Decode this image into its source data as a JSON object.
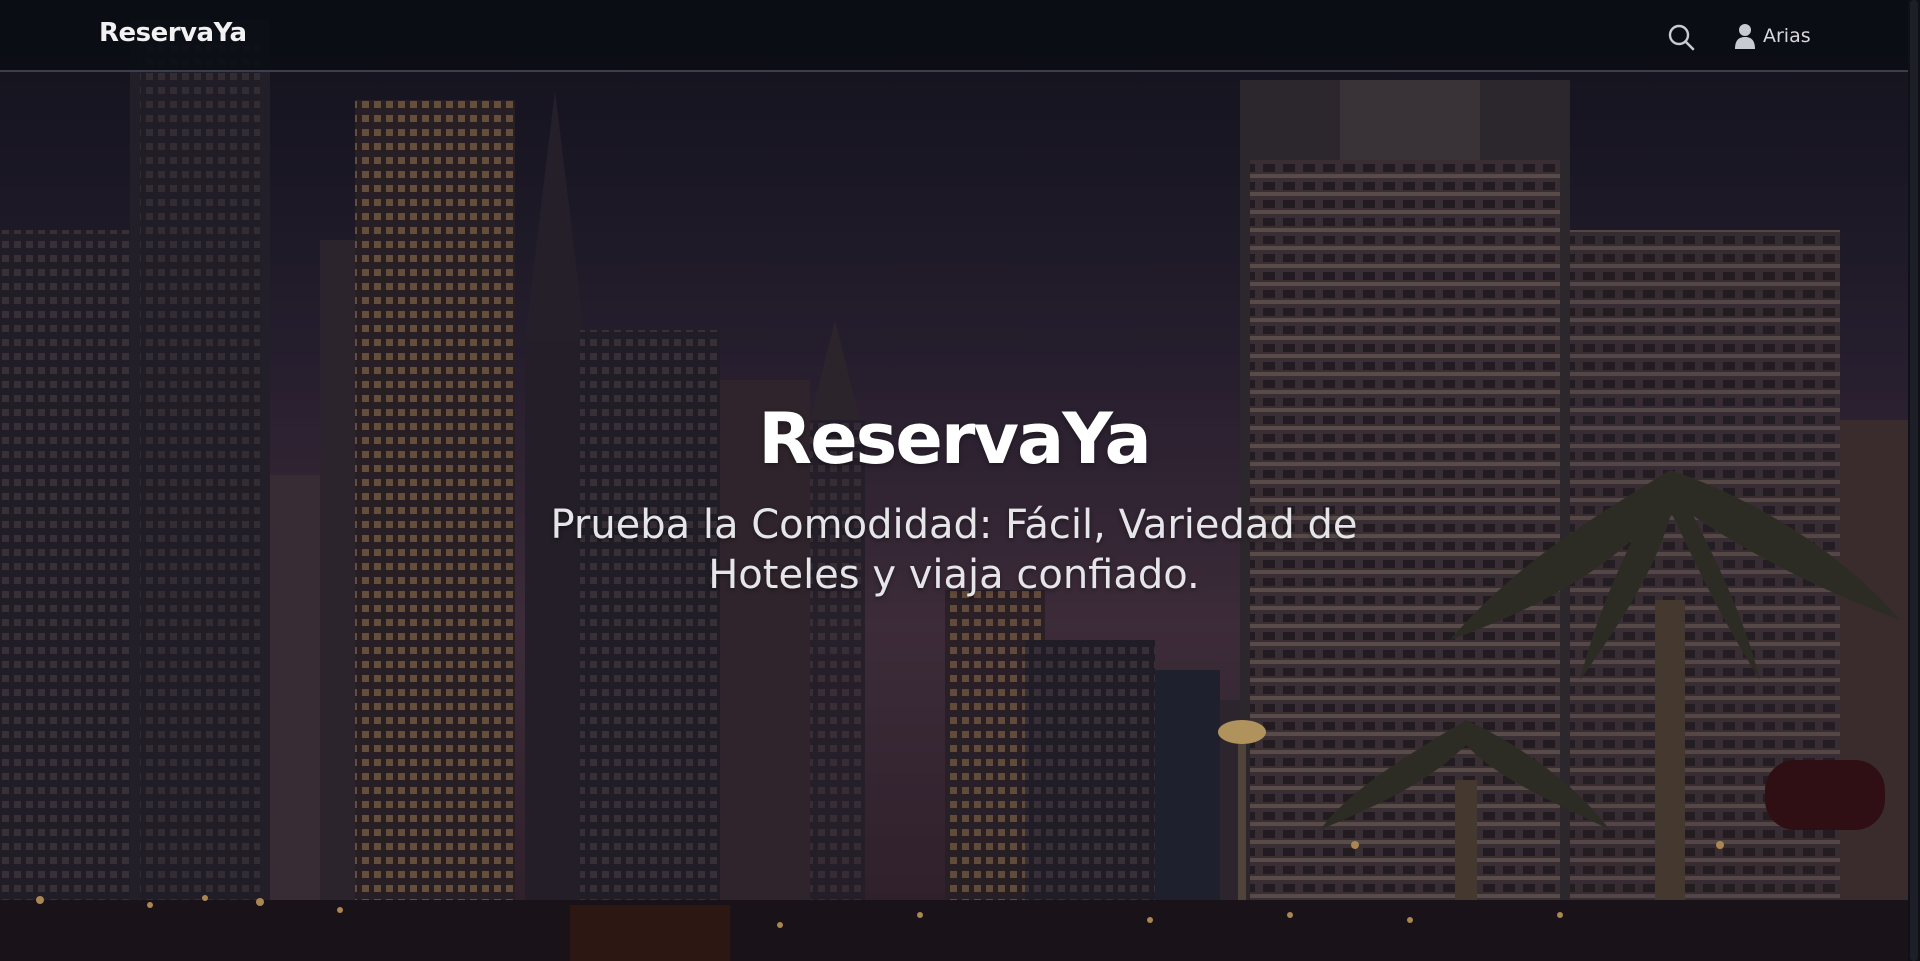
{
  "navbar": {
    "brand": "ReservaYa",
    "search_icon": "search-icon",
    "user_icon": "user-icon",
    "user_name": "Arias"
  },
  "hero": {
    "title": "ReservaYa",
    "subtitle": "Prueba la Comodidad: Fácil, Variedad de Hoteles y viaja confiado.",
    "background": "city-skyline-night-photo"
  },
  "colors": {
    "navbar_bg": "#0a0d14",
    "text_primary": "#ffffff",
    "text_secondary": "#e6e6ea"
  }
}
